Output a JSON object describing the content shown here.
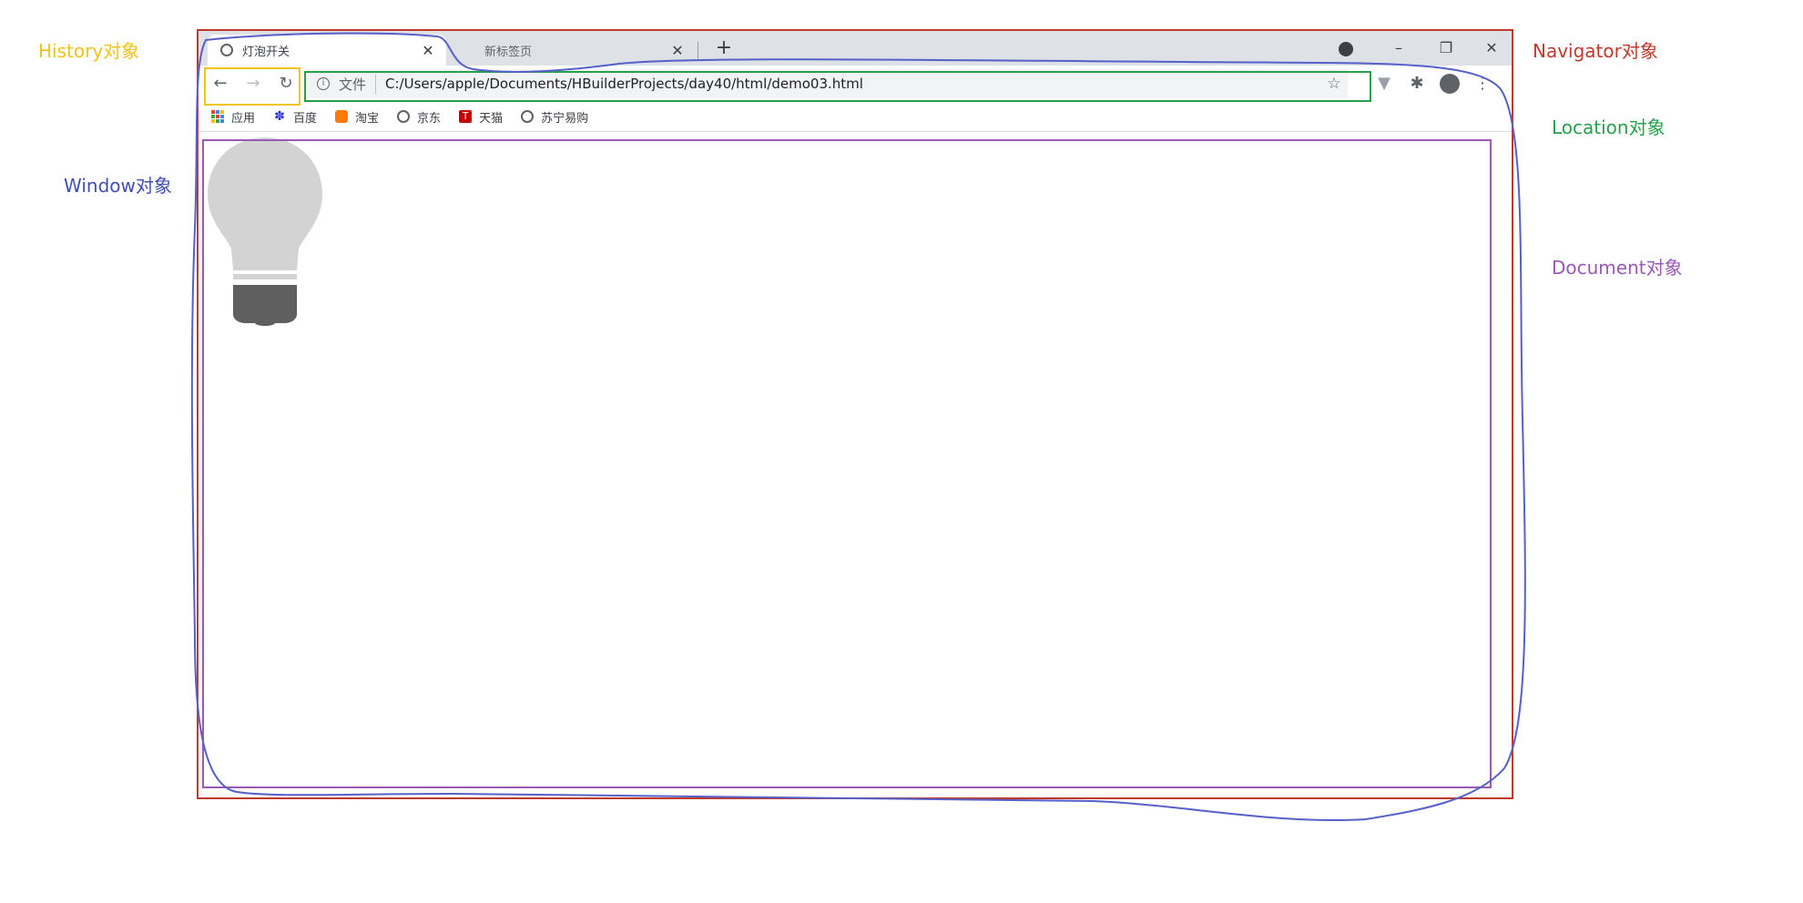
{
  "annotations": {
    "history": {
      "label": "History对象",
      "color": "#f0c419"
    },
    "window": {
      "label": "Window对象",
      "color": "#3f4fb5"
    },
    "navigator": {
      "label": "Navigator对象",
      "color": "#c0392b"
    },
    "location": {
      "label": "Location对象",
      "color": "#27a04b"
    },
    "document": {
      "label": "Document对象",
      "color": "#9b59b6"
    }
  },
  "browser": {
    "tabs": [
      {
        "title": "灯泡开关",
        "active": true
      },
      {
        "title": "新标签页",
        "active": false
      }
    ],
    "tab_close_glyph": "✕",
    "new_tab_glyph": "+",
    "window_controls": {
      "minimize": "–",
      "maximize": "❐",
      "close": "✕"
    },
    "nav": {
      "back": "←",
      "forward": "→",
      "reload": "↻"
    },
    "omnibox": {
      "security_chip": "文件",
      "url": "C:/Users/apple/Documents/HBuilderProjects/day40/html/demo03.html",
      "star_glyph": "☆"
    },
    "toolbar_icons": [
      "extension-icon",
      "puzzle-icon",
      "profile-icon",
      "menu-icon"
    ],
    "bookmarks": [
      {
        "label": "应用",
        "icon": "apps-grid-icon"
      },
      {
        "label": "百度",
        "icon": "baidu-paw-icon"
      },
      {
        "label": "淘宝",
        "icon": "taobao-icon"
      },
      {
        "label": "京东",
        "icon": "globe-icon"
      },
      {
        "label": "天猫",
        "icon": "tmall-icon"
      },
      {
        "label": "苏宁易购",
        "icon": "globe-icon"
      }
    ]
  },
  "page": {
    "bulb_state": "off",
    "bulb_icon": "lightbulb-icon",
    "bulb_colors": {
      "glass": "#d3d3d3",
      "base": "#5f5f5f"
    }
  }
}
